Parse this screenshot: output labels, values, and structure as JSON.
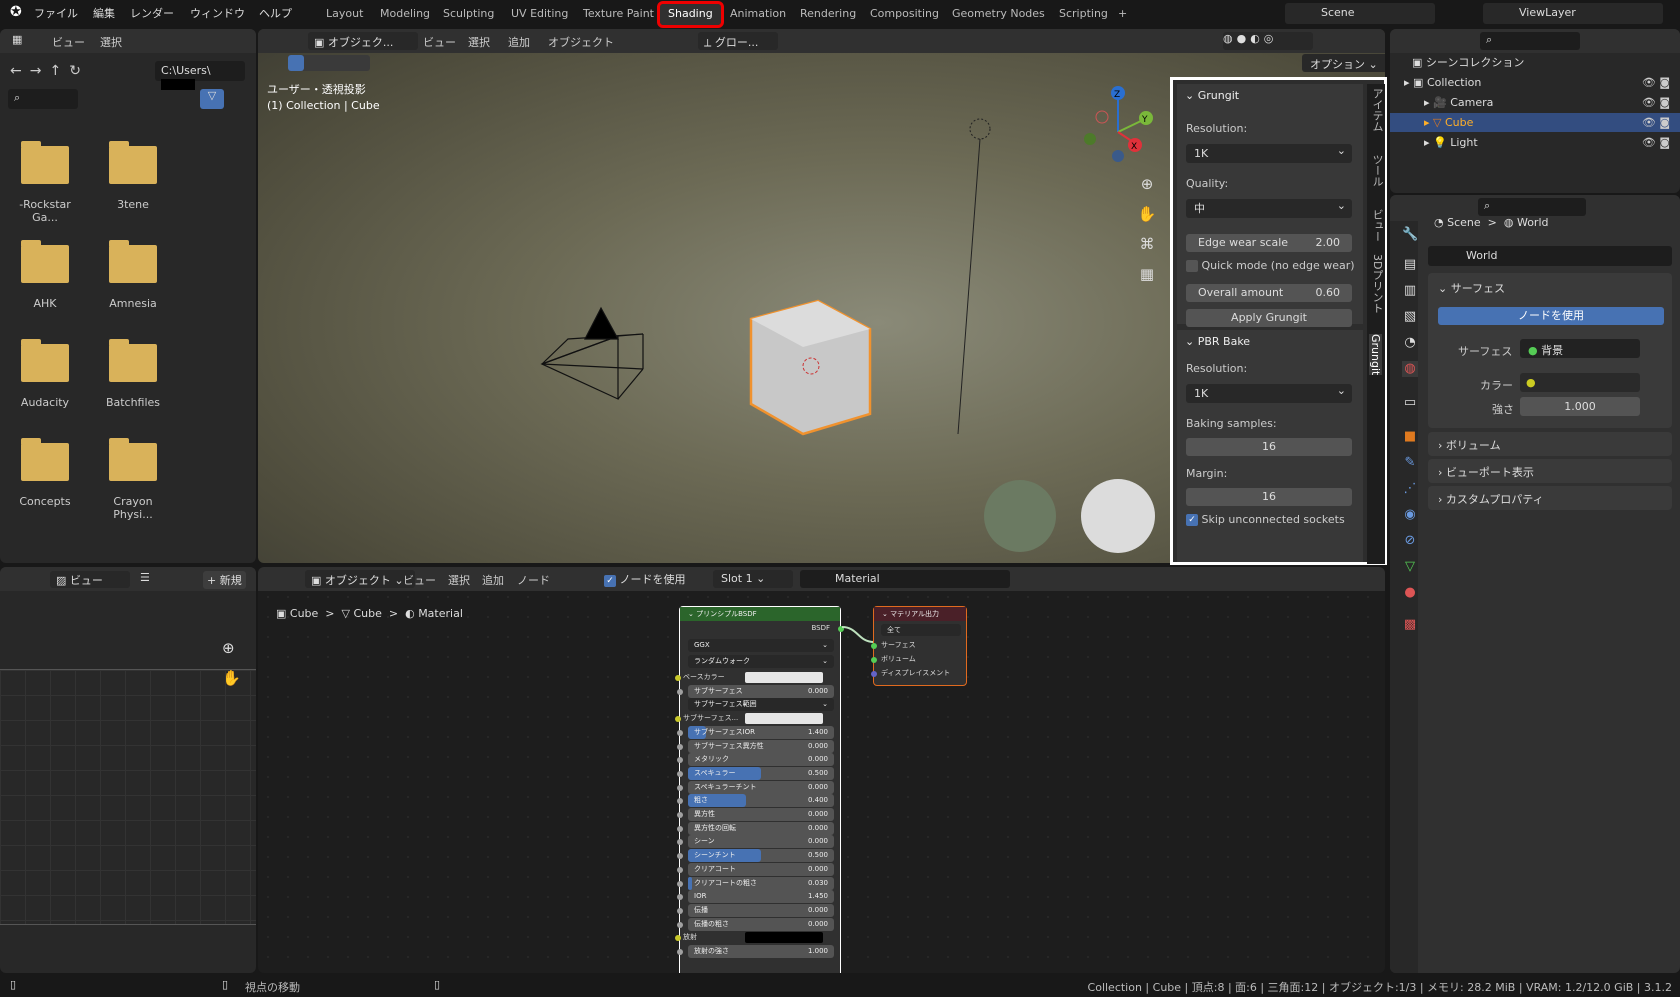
{
  "topbar": {
    "menus": [
      "ファイル",
      "編集",
      "レンダー",
      "ウィンドウ",
      "ヘルプ"
    ],
    "workspaces": [
      "Layout",
      "Modeling",
      "Sculpting",
      "UV Editing",
      "Texture Paint",
      "Shading",
      "Animation",
      "Rendering",
      "Compositing",
      "Geometry Nodes",
      "Scripting"
    ],
    "active_workspace": "Shading",
    "add_tab": "+",
    "scene": "Scene",
    "view_layer": "ViewLayer"
  },
  "file_browser": {
    "menu": [
      "ビュー",
      "選択"
    ],
    "path": "C:\\Users\\",
    "folders": [
      "-Rockstar Ga...",
      "3tene",
      "AHK",
      "Amnesia",
      "Audacity",
      "Batchfiles",
      "Concepts",
      "Crayon Physi..."
    ]
  },
  "viewport": {
    "mode": "オブジェク...",
    "menus": [
      "ビュー",
      "選択",
      "追加",
      "オブジェクト"
    ],
    "transform": "グロー...",
    "options": "オプション",
    "view_name": "ユーザー・透視投影",
    "collection_info": "(1) Collection | Cube",
    "gizmo": {
      "x": "X",
      "y": "Y",
      "z": "Z"
    },
    "side_tabs": [
      "アイテム",
      "ツール",
      "ビュー",
      "3Dプリント",
      "Grungit"
    ],
    "active_side_tab": "Grungit"
  },
  "grungit": {
    "title": "Grungit",
    "resolution_label": "Resolution:",
    "resolution": "1K",
    "quality_label": "Quality:",
    "quality": "中",
    "edge_wear_label": "Edge wear scale",
    "edge_wear": "2.00",
    "quick_mode": "Quick mode (no edge wear)",
    "quick_mode_checked": false,
    "overall_label": "Overall amount",
    "overall": "0.60",
    "apply": "Apply Grungit"
  },
  "pbr_bake": {
    "title": "PBR Bake",
    "resolution_label": "Resolution:",
    "resolution": "1K",
    "samples_label": "Baking samples:",
    "samples": "16",
    "margin_label": "Margin:",
    "margin": "16",
    "skip": "Skip unconnected sockets",
    "skip_checked": true
  },
  "outliner": {
    "root": "シーンコレクション",
    "items": [
      {
        "name": "Collection"
      },
      {
        "name": "Camera"
      },
      {
        "name": "Cube",
        "selected": true
      },
      {
        "name": "Light"
      }
    ]
  },
  "properties": {
    "breadcrumb": [
      "Scene",
      "World"
    ],
    "world_name": "World",
    "surface_panel": "サーフェス",
    "use_nodes": "ノードを使用",
    "surface_label": "サーフェス",
    "surface_value": "背景",
    "color_label": "カラー",
    "strength_label": "強さ",
    "strength": "1.000",
    "collapsed_panels": [
      "ボリューム",
      "ビューポート表示",
      "カスタムプロパティ"
    ]
  },
  "image_editor": {
    "view": "ビュー",
    "new": "新規"
  },
  "node_editor": {
    "mode": "オブジェクト",
    "menus": [
      "ビュー",
      "選択",
      "追加",
      "ノード"
    ],
    "use_nodes": "ノードを使用",
    "use_nodes_checked": true,
    "slot": "Slot 1",
    "material": "Material",
    "breadcrumb": [
      "Cube",
      "Cube",
      "Material"
    ],
    "bsdf": {
      "title": "プリンシプルBSDF",
      "output": "BSDF",
      "distribution": "GGX",
      "subsurface_method": "ランダムウォーク",
      "rows": [
        {
          "label": "ベースカラー",
          "type": "color",
          "color": "#e6e6e6",
          "socket": "#c7c729"
        },
        {
          "label": "サブサーフェス",
          "value": "0.000",
          "fill": 0
        },
        {
          "label": "サブサーフェス範囲",
          "type": "dropdown",
          "socket": "#6363c7"
        },
        {
          "label": "サブサーフェス...",
          "type": "color",
          "color": "#e6e6e6",
          "socket": "#c7c729"
        },
        {
          "label": "サブサーフェスIOR",
          "value": "1.400",
          "fill": 0.12
        },
        {
          "label": "サブサーフェス異方性",
          "value": "0.000",
          "fill": 0
        },
        {
          "label": "メタリック",
          "value": "0.000",
          "fill": 0
        },
        {
          "label": "スペキュラー",
          "value": "0.500",
          "fill": 0.5
        },
        {
          "label": "スペキュラーチント",
          "value": "0.000",
          "fill": 0
        },
        {
          "label": "粗さ",
          "value": "0.400",
          "fill": 0.4
        },
        {
          "label": "異方性",
          "value": "0.000",
          "fill": 0
        },
        {
          "label": "異方性の回転",
          "value": "0.000",
          "fill": 0
        },
        {
          "label": "シーン",
          "value": "0.000",
          "fill": 0
        },
        {
          "label": "シーンチント",
          "value": "0.500",
          "fill": 0.5
        },
        {
          "label": "クリアコート",
          "value": "0.000",
          "fill": 0
        },
        {
          "label": "クリアコートの粗さ",
          "value": "0.030",
          "fill": 0.03
        },
        {
          "label": "IOR",
          "value": "1.450",
          "fill": 0
        },
        {
          "label": "伝播",
          "value": "0.000",
          "fill": 0
        },
        {
          "label": "伝播の粗さ",
          "value": "0.000",
          "fill": 0
        },
        {
          "label": "放射",
          "type": "color",
          "color": "#000000",
          "socket": "#c7c729"
        },
        {
          "label": "放射の強さ",
          "value": "1.000",
          "fill": 0
        }
      ]
    },
    "output": {
      "title": "マテリアル出力",
      "target": "全て",
      "inputs": [
        "サーフェス",
        "ボリューム",
        "ディスプレイスメント"
      ]
    }
  },
  "statusbar": {
    "hint": "視点の移動",
    "info": "Collection | Cube | 頂点:8 | 面:6 | 三角面:12 | オブジェクト:1/3 | メモリ: 28.2 MiB | VRAM: 1.2/12.0 GiB | 3.1.2"
  },
  "colors": {
    "accent": "#4772b3",
    "selection": "#e07a1f",
    "highlight_box": "#ffffff",
    "active_tab": "#ff0000"
  }
}
